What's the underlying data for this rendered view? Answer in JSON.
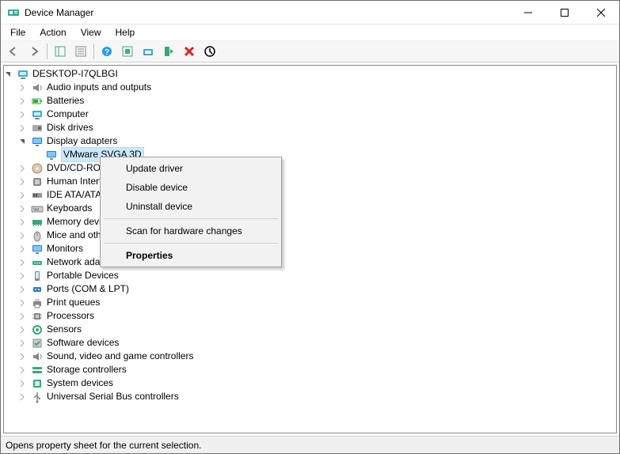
{
  "window": {
    "title": "Device Manager"
  },
  "menubar": {
    "file": "File",
    "action": "Action",
    "view": "View",
    "help": "Help"
  },
  "tree": {
    "root": "DESKTOP-I7QLBGI",
    "nodes": [
      {
        "label": "Audio inputs and outputs",
        "icon": "audio"
      },
      {
        "label": "Batteries",
        "icon": "battery"
      },
      {
        "label": "Computer",
        "icon": "computer"
      },
      {
        "label": "Disk drives",
        "icon": "disk"
      },
      {
        "label": "Display adapters",
        "icon": "display",
        "expanded": true,
        "children": [
          {
            "label": "VMware SVGA 3D",
            "icon": "display",
            "selected": true
          }
        ]
      },
      {
        "label": "DVD/CD-ROM drives",
        "icon": "dvd"
      },
      {
        "label": "Human Interface Devices",
        "icon": "hid"
      },
      {
        "label": "IDE ATA/ATAPI controllers",
        "icon": "ide"
      },
      {
        "label": "Keyboards",
        "icon": "keyboard"
      },
      {
        "label": "Memory devices",
        "icon": "memory"
      },
      {
        "label": "Mice and other pointing devices",
        "icon": "mouse"
      },
      {
        "label": "Monitors",
        "icon": "monitor"
      },
      {
        "label": "Network adapters",
        "icon": "network"
      },
      {
        "label": "Portable Devices",
        "icon": "portable"
      },
      {
        "label": "Ports (COM & LPT)",
        "icon": "port"
      },
      {
        "label": "Print queues",
        "icon": "printer"
      },
      {
        "label": "Processors",
        "icon": "cpu"
      },
      {
        "label": "Sensors",
        "icon": "sensor"
      },
      {
        "label": "Software devices",
        "icon": "software"
      },
      {
        "label": "Sound, video and game controllers",
        "icon": "sound"
      },
      {
        "label": "Storage controllers",
        "icon": "storage"
      },
      {
        "label": "System devices",
        "icon": "system"
      },
      {
        "label": "Universal Serial Bus controllers",
        "icon": "usb"
      }
    ]
  },
  "context_menu": {
    "update": "Update driver",
    "disable": "Disable device",
    "uninstall": "Uninstall device",
    "scan": "Scan for hardware changes",
    "properties": "Properties"
  },
  "statusbar": {
    "text": "Opens property sheet for the current selection."
  }
}
